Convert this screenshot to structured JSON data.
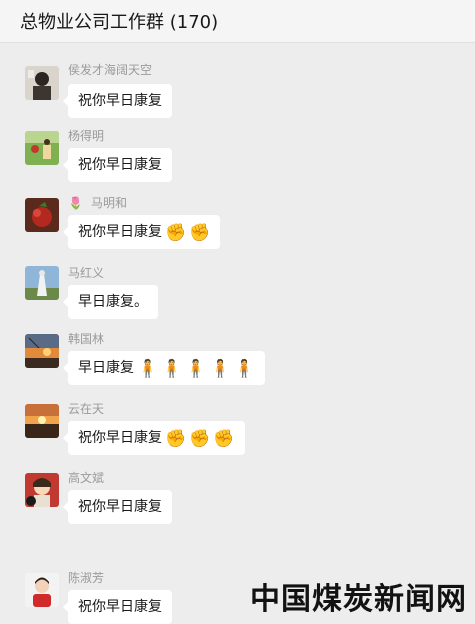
{
  "header": {
    "title": "总物业公司工作群 (170)"
  },
  "messages": [
    {
      "sender": "侯发才海阔天空",
      "text": "祝你早日康复",
      "emoji": [],
      "emoji_type": ""
    },
    {
      "sender": "杨得明",
      "text": "祝你早日康复",
      "emoji": [],
      "emoji_type": ""
    },
    {
      "sender": "马明和",
      "sender_icon": "rose-icon",
      "text": "祝你早日康复",
      "emoji": [
        "✊",
        "✊"
      ],
      "emoji_type": "fist-emoji"
    },
    {
      "sender": "马红义",
      "text": "早日康复。",
      "emoji": [],
      "emoji_type": ""
    },
    {
      "sender": "韩国林",
      "text": "早日康复",
      "emoji": [
        "🧍",
        "🧍",
        "🧍",
        "🧍",
        "🧍"
      ],
      "emoji_type": "pray-person-emoji"
    },
    {
      "sender": "云在天",
      "text": "祝你早日康复",
      "emoji": [
        "✊",
        "✊",
        "✊"
      ],
      "emoji_type": "fist-emoji"
    },
    {
      "sender": "高文斌",
      "text": "祝你早日康复",
      "emoji": [],
      "emoji_type": ""
    },
    {
      "sender": "陈淑芳",
      "text": "祝你早日康复",
      "emoji": [],
      "emoji_type": ""
    }
  ],
  "watermark": "中国煤炭新闻网",
  "colors": {
    "background": "#ededed",
    "bubble": "#ffffff",
    "sender_name": "#9a9a9a",
    "fist": "#e7a52a"
  }
}
